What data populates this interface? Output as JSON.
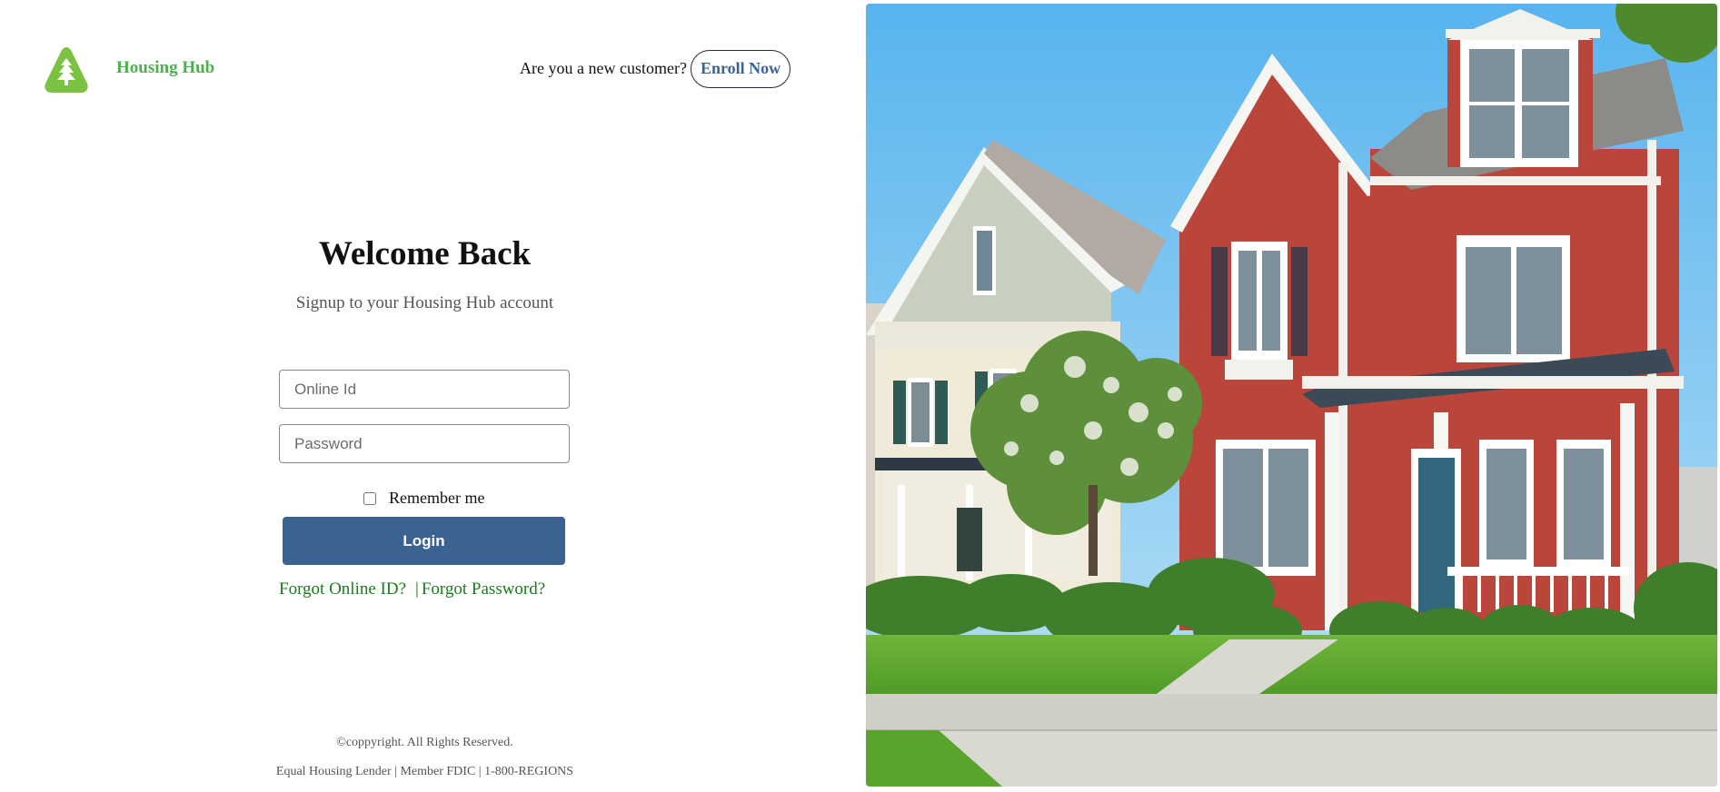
{
  "brand": {
    "name": "Housing Hub",
    "logo_icon": "tree-triangle-icon",
    "color": "#4caf50"
  },
  "header": {
    "new_customer_text": "Are you a new customer?",
    "enroll_label": "Enroll Now"
  },
  "login": {
    "title": "Welcome Back",
    "subtitle": "Signup to your Housing Hub account",
    "online_id_placeholder": "Online Id",
    "online_id_value": "",
    "password_placeholder": "Password",
    "password_value": "",
    "remember_label": "Remember me",
    "remember_checked": false,
    "login_label": "Login",
    "forgot_id_label": "Forgot Online ID?",
    "separator": "|",
    "forgot_password_label": "Forgot Password?"
  },
  "footer": {
    "copyright": "©coppyright. All Rights Reserved.",
    "legal": "Equal Housing Lender | Member FDIC | 1-800-REGIONS"
  },
  "colors": {
    "primary": "#3b6391",
    "link_green": "#1a7d1a",
    "brand_green": "#4caf50"
  },
  "hero_image": {
    "description_icon": "house-photo"
  }
}
